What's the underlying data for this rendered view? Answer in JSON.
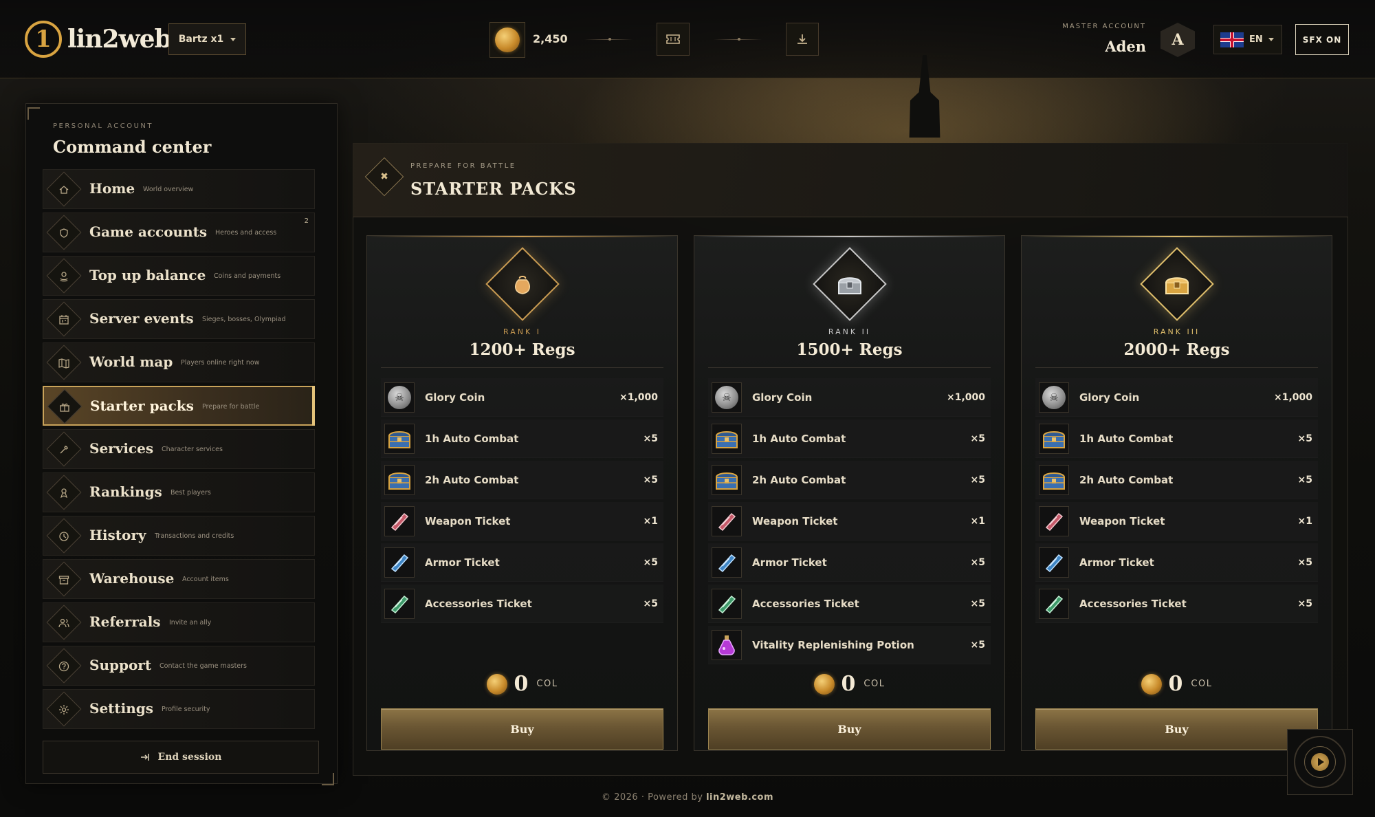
{
  "brand": {
    "name": "lin2web",
    "mark": "1"
  },
  "header": {
    "server_select": "Bartz x1",
    "balance": "2,450",
    "master_label": "MASTER ACCOUNT",
    "master_name": "Aden",
    "avatar_initial": "A",
    "language": "EN",
    "sfx": "SFX ON"
  },
  "sidebar": {
    "eyebrow": "PERSONAL ACCOUNT",
    "title": "Command center",
    "items": [
      {
        "label": "Home",
        "sub": "World overview",
        "icon": "home-icon"
      },
      {
        "label": "Game accounts",
        "sub": "Heroes and access",
        "icon": "shield-icon",
        "badge": "2"
      },
      {
        "label": "Top up balance",
        "sub": "Coins and payments",
        "icon": "coins-icon"
      },
      {
        "label": "Server events",
        "sub": "Sieges, bosses, Olympiad",
        "icon": "calendar-icon"
      },
      {
        "label": "World map",
        "sub": "Players online right now",
        "icon": "map-icon"
      },
      {
        "label": "Starter packs",
        "sub": "Prepare for battle",
        "icon": "gift-icon",
        "active": true
      },
      {
        "label": "Services",
        "sub": "Character services",
        "icon": "wrench-icon"
      },
      {
        "label": "Rankings",
        "sub": "Best players",
        "icon": "medal-icon"
      },
      {
        "label": "History",
        "sub": "Transactions and credits",
        "icon": "clock-icon"
      },
      {
        "label": "Warehouse",
        "sub": "Account items",
        "icon": "box-icon"
      },
      {
        "label": "Referrals",
        "sub": "Invite an ally",
        "icon": "users-icon"
      },
      {
        "label": "Support",
        "sub": "Contact the game masters",
        "icon": "help-icon"
      },
      {
        "label": "Settings",
        "sub": "Profile security",
        "icon": "gear-icon"
      }
    ],
    "end_session": "End session"
  },
  "main": {
    "eyebrow": "PREPARE FOR BATTLE",
    "title": "STARTER PACKS"
  },
  "packs": [
    {
      "rank": "RANK I",
      "title": "1200+ Regs",
      "icon": "bag-icon",
      "accent": "#c99b52",
      "items": [
        {
          "name": "Glory Coin",
          "qty": "×1,000",
          "icon": "skull-coin-icon"
        },
        {
          "name": "1h Auto Combat",
          "qty": "×5",
          "icon": "chest-icon"
        },
        {
          "name": "2h Auto Combat",
          "qty": "×5",
          "icon": "chest-icon"
        },
        {
          "name": "Weapon Ticket",
          "qty": "×1",
          "icon": "weapon-ticket-icon"
        },
        {
          "name": "Armor Ticket",
          "qty": "×5",
          "icon": "armor-ticket-icon"
        },
        {
          "name": "Accessories Ticket",
          "qty": "×5",
          "icon": "accessories-ticket-icon"
        }
      ],
      "price": "0",
      "currency": "COL",
      "buy": "Buy"
    },
    {
      "rank": "RANK II",
      "title": "1500+ Regs",
      "icon": "silver-chest-icon",
      "accent": "#c8c8c8",
      "items": [
        {
          "name": "Glory Coin",
          "qty": "×1,000",
          "icon": "skull-coin-icon"
        },
        {
          "name": "1h Auto Combat",
          "qty": "×5",
          "icon": "chest-icon"
        },
        {
          "name": "2h Auto Combat",
          "qty": "×5",
          "icon": "chest-icon"
        },
        {
          "name": "Weapon Ticket",
          "qty": "×1",
          "icon": "weapon-ticket-icon"
        },
        {
          "name": "Armor Ticket",
          "qty": "×5",
          "icon": "armor-ticket-icon"
        },
        {
          "name": "Accessories Ticket",
          "qty": "×5",
          "icon": "accessories-ticket-icon"
        },
        {
          "name": "Vitality Replenishing Potion",
          "qty": "×5",
          "icon": "potion-icon"
        }
      ],
      "price": "0",
      "currency": "COL",
      "buy": "Buy"
    },
    {
      "rank": "RANK III",
      "title": "2000+ Regs",
      "icon": "gold-chest-icon",
      "accent": "#e0bf6c",
      "items": [
        {
          "name": "Glory Coin",
          "qty": "×1,000",
          "icon": "skull-coin-icon"
        },
        {
          "name": "1h Auto Combat",
          "qty": "×5",
          "icon": "chest-icon"
        },
        {
          "name": "2h Auto Combat",
          "qty": "×5",
          "icon": "chest-icon"
        },
        {
          "name": "Weapon Ticket",
          "qty": "×1",
          "icon": "weapon-ticket-icon"
        },
        {
          "name": "Armor Ticket",
          "qty": "×5",
          "icon": "armor-ticket-icon"
        },
        {
          "name": "Accessories Ticket",
          "qty": "×5",
          "icon": "accessories-ticket-icon"
        }
      ],
      "price": "0",
      "currency": "COL",
      "buy": "Buy"
    }
  ],
  "footer": {
    "prefix": "© 2026 · Powered by ",
    "link": "lin2web.com"
  }
}
